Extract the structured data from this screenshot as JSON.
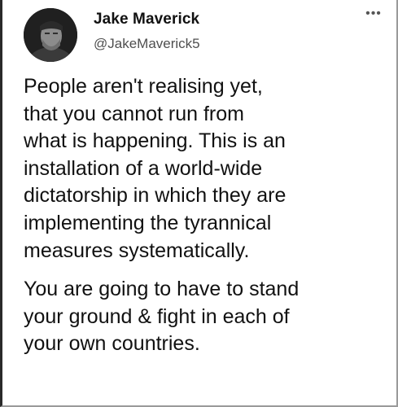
{
  "tweet": {
    "display_name": "Jake Maverick",
    "handle": "@JakeMaverick5",
    "more_icon": "more-horizontal-icon",
    "paragraphs": [
      [
        "People aren't realising yet,",
        "that you cannot run from",
        "what is happening. This is an",
        "installation of a world-wide",
        "dictatorship in which they are",
        "implementing the tyrannical",
        "measures systematically."
      ],
      [
        "You are going to have to stand",
        "your ground & fight in each of",
        "your own countries."
      ]
    ]
  }
}
